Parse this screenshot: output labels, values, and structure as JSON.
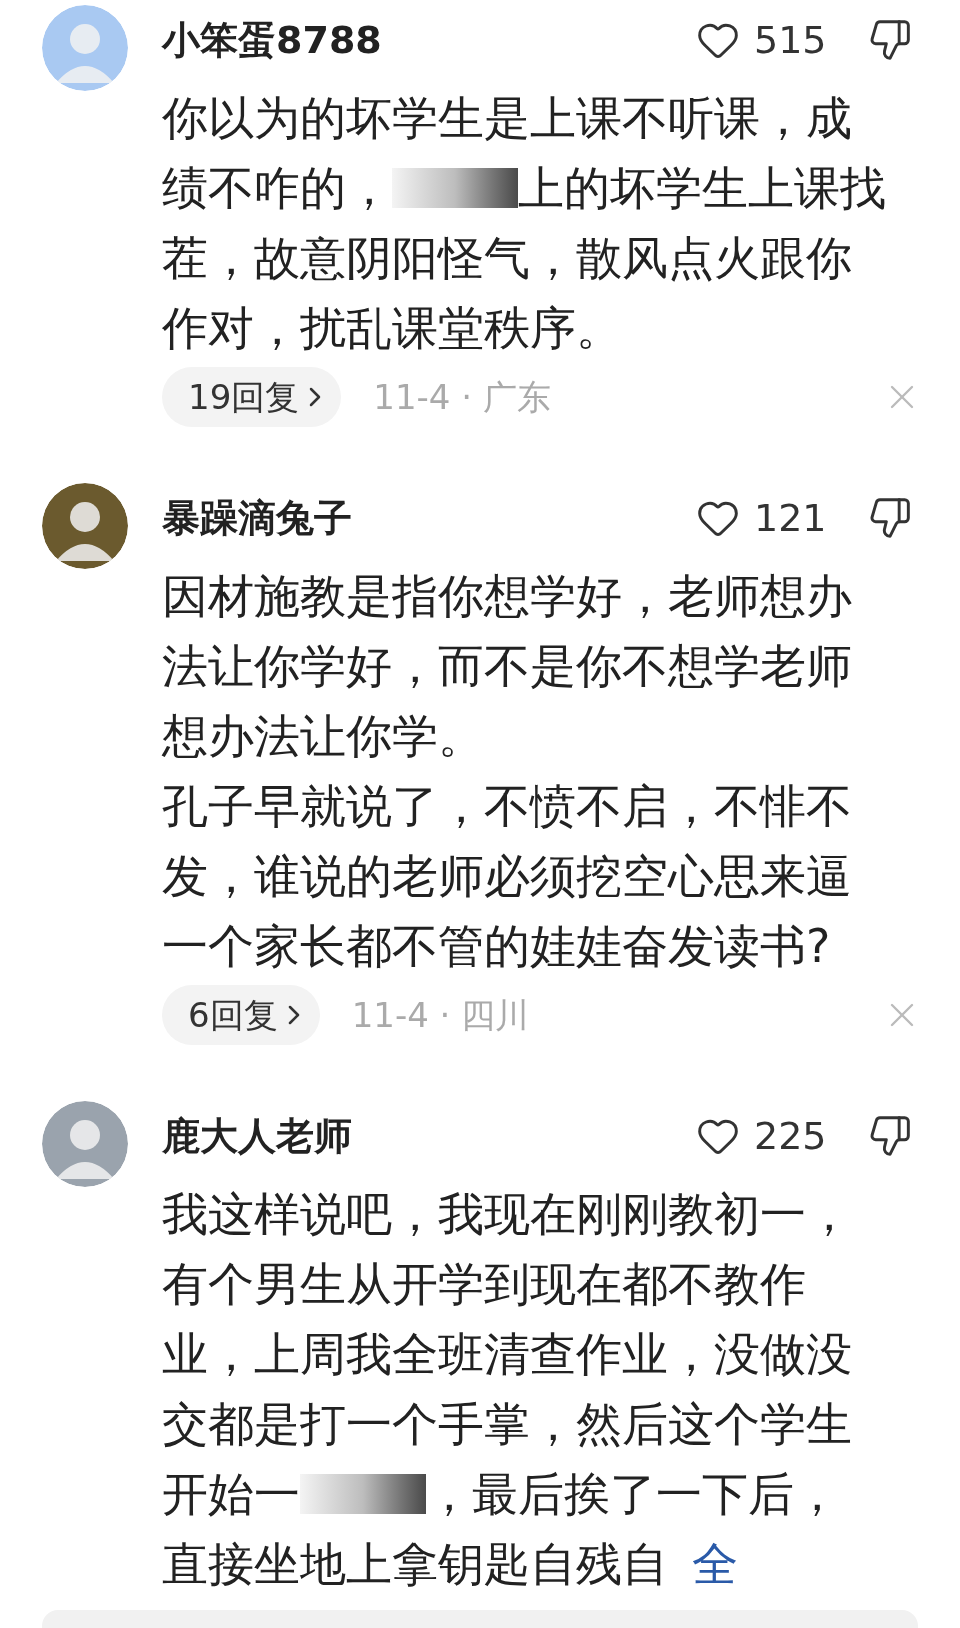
{
  "comments": [
    {
      "user": "小笨蛋8788",
      "avatar": {
        "color": "#a9c9f2"
      },
      "likes": "515",
      "lines": [
        [
          {
            "kind": "text",
            "text": "你以为的坏学生是上课不听课，成"
          }
        ],
        [
          {
            "kind": "text",
            "text": "绩不咋的，"
          },
          {
            "kind": "redacted"
          },
          {
            "kind": "text",
            "text": "上的坏学生上课找"
          }
        ],
        [
          {
            "kind": "text",
            "text": "茬，故意阴阳怪气，散风点火跟你"
          }
        ],
        [
          {
            "kind": "text",
            "text": "作对，扰乱课堂秩序。"
          }
        ]
      ],
      "replies": "19回复",
      "meta": "11-4 · 广东"
    },
    {
      "user": "暴躁滴兔子",
      "avatar": {
        "color": "#6b5a2e"
      },
      "likes": "121",
      "lines": [
        [
          {
            "kind": "text",
            "text": "因材施教是指你想学好，老师想办"
          }
        ],
        [
          {
            "kind": "text",
            "text": "法让你学好，而不是你不想学老师"
          }
        ],
        [
          {
            "kind": "text",
            "text": "想办法让你学。"
          }
        ],
        [
          {
            "kind": "text",
            "text": "孔子早就说了，不愤不启，不悱不"
          }
        ],
        [
          {
            "kind": "text",
            "text": "发，谁说的老师必须挖空心思来逼"
          }
        ],
        [
          {
            "kind": "text",
            "text": "一个家长都不管的娃娃奋发读书?"
          }
        ]
      ],
      "replies": "6回复",
      "meta": "11-4 · 四川"
    },
    {
      "user": "鹿大人老师",
      "avatar": {
        "color": "#9aa3ad"
      },
      "likes": "225",
      "lines": [
        [
          {
            "kind": "text",
            "text": "我这样说吧，我现在刚刚教初一，"
          }
        ],
        [
          {
            "kind": "text",
            "text": "有个男生从开学到现在都不教作"
          }
        ],
        [
          {
            "kind": "text",
            "text": "业，上周我全班清查作业，没做没"
          }
        ],
        [
          {
            "kind": "text",
            "text": "交都是打一个手掌，然后这个学生"
          }
        ],
        [
          {
            "kind": "text",
            "text": "开始一"
          },
          {
            "kind": "redacted"
          },
          {
            "kind": "text",
            "text": "，最后挨了一下后，"
          }
        ],
        [
          {
            "kind": "text",
            "text": "直接坐地上拿钥匙自残自"
          },
          {
            "kind": "link",
            "text": "全"
          }
        ]
      ]
    }
  ]
}
